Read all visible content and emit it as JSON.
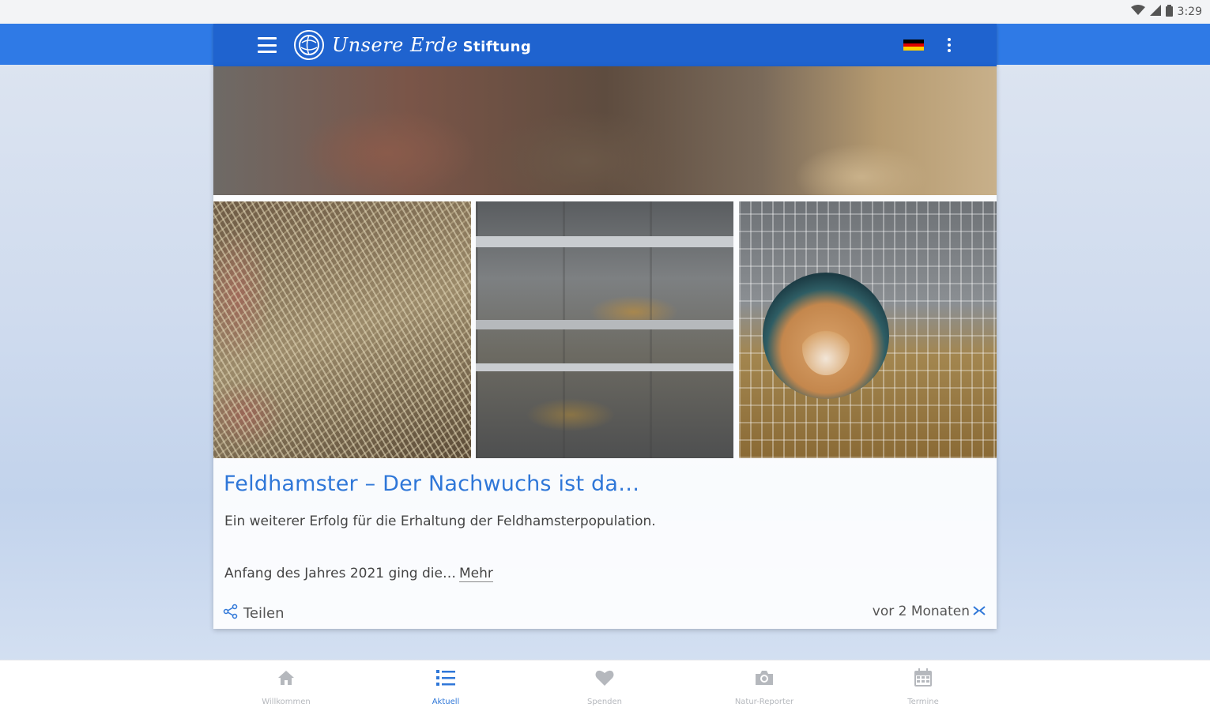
{
  "status_bar": {
    "time": "3:29"
  },
  "app_bar": {
    "logo_script": "Unsere Erde",
    "logo_word": "Stiftung",
    "language_flag": "german-flag",
    "flag_colors": [
      "#000000",
      "#dd0000",
      "#ffce00"
    ]
  },
  "post": {
    "title": "Feldhamster – Der Nachwuchs ist da…",
    "excerpt_line1": "Ein weiterer Erfolg für die Erhaltung der Feldhamsterpopulation.",
    "excerpt_line2": "Anfang des Jahres 2021 ging die…",
    "more_label": "Mehr",
    "share_label": "Teilen",
    "time_ago": "vor 2 Monaten"
  },
  "bottom_nav": {
    "items": [
      {
        "label": "Willkommen",
        "icon": "home-icon"
      },
      {
        "label": "Aktuell",
        "icon": "list-icon",
        "active": true
      },
      {
        "label": "Spenden",
        "icon": "heart-icon"
      },
      {
        "label": "Natur-Reporter",
        "icon": "camera-icon"
      },
      {
        "label": "Termine",
        "icon": "calendar-icon"
      }
    ]
  },
  "colors": {
    "accent": "#2f77d8",
    "app_bar": "#1f63cf",
    "app_bar_outer": "#2f7ae6",
    "inactive_nav": "#b5b8bd"
  }
}
